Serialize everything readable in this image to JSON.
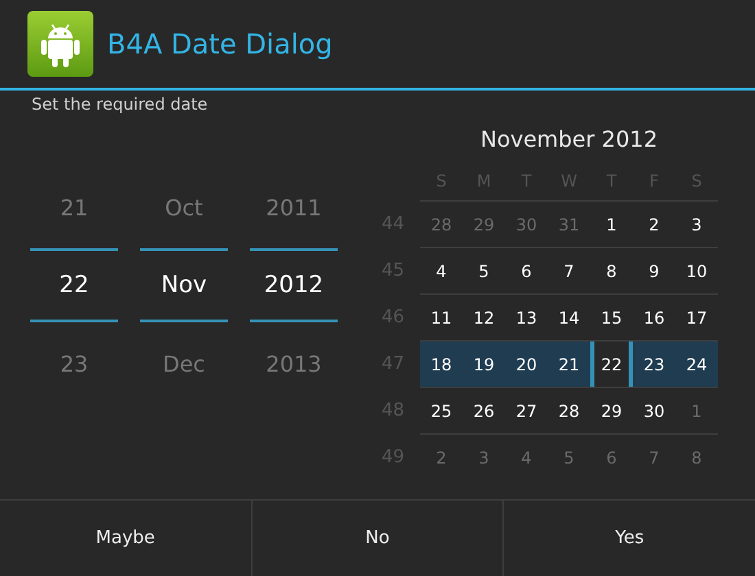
{
  "window": {
    "title": "B4A Date Dialog"
  },
  "message": "Set the required date",
  "pickers": [
    {
      "items": [
        {
          "text": "21",
          "selected": false
        },
        {
          "text": "22",
          "selected": true
        },
        {
          "text": "23",
          "selected": false
        }
      ]
    },
    {
      "items": [
        {
          "text": "Oct",
          "selected": false
        },
        {
          "text": "Nov",
          "selected": true
        },
        {
          "text": "Dec",
          "selected": false
        }
      ]
    },
    {
      "items": [
        {
          "text": "2011",
          "selected": false
        },
        {
          "text": "2012",
          "selected": true
        },
        {
          "text": "2013",
          "selected": false
        }
      ]
    }
  ],
  "calendar": {
    "title": "November 2012",
    "weekdays": [
      "S",
      "M",
      "T",
      "W",
      "T",
      "F",
      "S"
    ],
    "weeks": [
      {
        "number": "44",
        "selected": false,
        "days": [
          {
            "text": "28",
            "in_month": false,
            "selected": false
          },
          {
            "text": "29",
            "in_month": false,
            "selected": false
          },
          {
            "text": "30",
            "in_month": false,
            "selected": false
          },
          {
            "text": "31",
            "in_month": false,
            "selected": false
          },
          {
            "text": "1",
            "in_month": true,
            "selected": false
          },
          {
            "text": "2",
            "in_month": true,
            "selected": false
          },
          {
            "text": "3",
            "in_month": true,
            "selected": false
          }
        ]
      },
      {
        "number": "45",
        "selected": false,
        "days": [
          {
            "text": "4",
            "in_month": true,
            "selected": false
          },
          {
            "text": "5",
            "in_month": true,
            "selected": false
          },
          {
            "text": "6",
            "in_month": true,
            "selected": false
          },
          {
            "text": "7",
            "in_month": true,
            "selected": false
          },
          {
            "text": "8",
            "in_month": true,
            "selected": false
          },
          {
            "text": "9",
            "in_month": true,
            "selected": false
          },
          {
            "text": "10",
            "in_month": true,
            "selected": false
          }
        ]
      },
      {
        "number": "46",
        "selected": false,
        "days": [
          {
            "text": "11",
            "in_month": true,
            "selected": false
          },
          {
            "text": "12",
            "in_month": true,
            "selected": false
          },
          {
            "text": "13",
            "in_month": true,
            "selected": false
          },
          {
            "text": "14",
            "in_month": true,
            "selected": false
          },
          {
            "text": "15",
            "in_month": true,
            "selected": false
          },
          {
            "text": "16",
            "in_month": true,
            "selected": false
          },
          {
            "text": "17",
            "in_month": true,
            "selected": false
          }
        ]
      },
      {
        "number": "47",
        "selected": true,
        "days": [
          {
            "text": "18",
            "in_month": true,
            "selected": false
          },
          {
            "text": "19",
            "in_month": true,
            "selected": false
          },
          {
            "text": "20",
            "in_month": true,
            "selected": false
          },
          {
            "text": "21",
            "in_month": true,
            "selected": false
          },
          {
            "text": "22",
            "in_month": true,
            "selected": true
          },
          {
            "text": "23",
            "in_month": true,
            "selected": false
          },
          {
            "text": "24",
            "in_month": true,
            "selected": false
          }
        ]
      },
      {
        "number": "48",
        "selected": false,
        "days": [
          {
            "text": "25",
            "in_month": true,
            "selected": false
          },
          {
            "text": "26",
            "in_month": true,
            "selected": false
          },
          {
            "text": "27",
            "in_month": true,
            "selected": false
          },
          {
            "text": "28",
            "in_month": true,
            "selected": false
          },
          {
            "text": "29",
            "in_month": true,
            "selected": false
          },
          {
            "text": "30",
            "in_month": true,
            "selected": false
          },
          {
            "text": "1",
            "in_month": false,
            "selected": false
          }
        ]
      },
      {
        "number": "49",
        "selected": false,
        "days": [
          {
            "text": "2",
            "in_month": false,
            "selected": false
          },
          {
            "text": "3",
            "in_month": false,
            "selected": false
          },
          {
            "text": "4",
            "in_month": false,
            "selected": false
          },
          {
            "text": "5",
            "in_month": false,
            "selected": false
          },
          {
            "text": "6",
            "in_month": false,
            "selected": false
          },
          {
            "text": "7",
            "in_month": false,
            "selected": false
          },
          {
            "text": "8",
            "in_month": false,
            "selected": false
          }
        ]
      }
    ]
  },
  "buttons": [
    "Maybe",
    "No",
    "Yes"
  ]
}
